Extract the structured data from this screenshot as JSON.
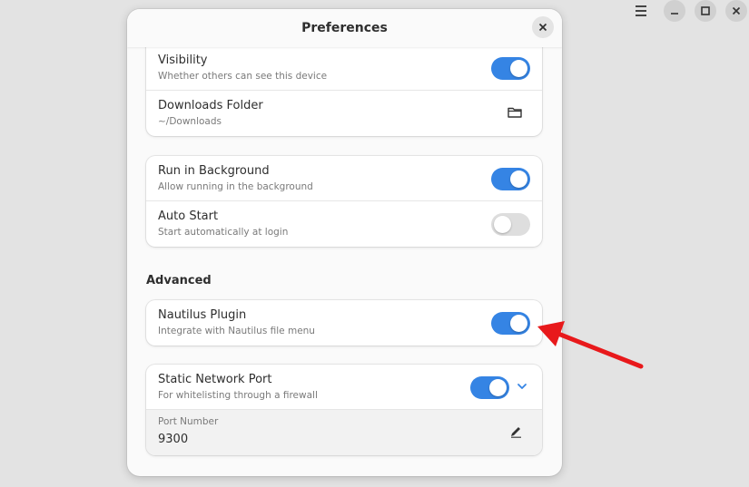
{
  "window": {
    "icons": {
      "menu": "hamburger-icon",
      "minimize": "minimize-icon",
      "maximize": "maximize-icon",
      "close": "close-icon"
    }
  },
  "dialog": {
    "title": "Preferences",
    "close_icon": "close-icon"
  },
  "groups": [
    {
      "rows": [
        {
          "title": "Visibility",
          "subtitle": "Whether others can see this device",
          "toggle": true
        },
        {
          "title": "Downloads Folder",
          "subtitle": "~/Downloads",
          "icon": "folder-icon"
        }
      ]
    },
    {
      "rows": [
        {
          "title": "Run in Background",
          "subtitle": "Allow running in the background",
          "toggle": true
        },
        {
          "title": "Auto Start",
          "subtitle": "Start automatically at login",
          "toggle": false
        }
      ]
    }
  ],
  "advanced": {
    "heading": "Advanced",
    "nautilus": {
      "title": "Nautilus Plugin",
      "subtitle": "Integrate with Nautilus file menu",
      "toggle": true
    },
    "static_port": {
      "title": "Static Network Port",
      "subtitle": "For whitelisting through a firewall",
      "toggle": true,
      "expanded": true,
      "port_label": "Port Number",
      "port_value": "9300",
      "edit_icon": "edit-pencil-icon"
    }
  },
  "colors": {
    "accent": "#3584e4",
    "annotation_arrow": "#e8191b"
  }
}
